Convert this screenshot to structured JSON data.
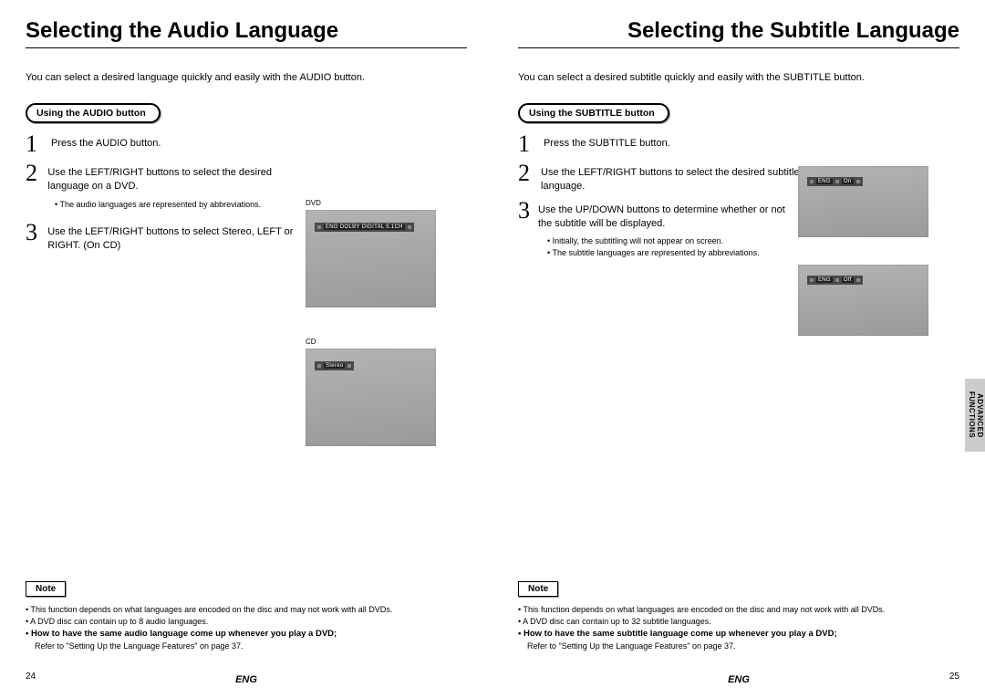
{
  "left": {
    "title": "Selecting the Audio Language",
    "intro": "You can select a desired language quickly and easily with the AUDIO button.",
    "pill": "Using the AUDIO button",
    "steps": [
      {
        "n": "1",
        "text": "Press the AUDIO button."
      },
      {
        "n": "2",
        "text": "Use the LEFT/RIGHT buttons to select the desired language on a DVD."
      },
      {
        "n": "3",
        "text": "Use the LEFT/RIGHT buttons to select Stereo, LEFT or RIGHT. (On CD)"
      }
    ],
    "sub_after_2": "The audio languages are represented by abbreviations.",
    "screens": {
      "dvd_label": "DVD",
      "dvd_bar": "ENG DOLBY DIGITAL 5.1CH",
      "cd_label": "CD",
      "cd_bar": "Stereo"
    },
    "note": {
      "label": "Note",
      "lines": [
        "This function depends on what languages are encoded on the disc and may not work with all DVDs.",
        "A DVD disc can contain up to 8 audio languages."
      ],
      "bold": "How to have the same audio language come up whenever you play a DVD;",
      "refer": "Refer to \"Setting Up the Language Features\" on page 37."
    },
    "pagenum": "24",
    "lang": "ENG"
  },
  "right": {
    "title": "Selecting the Subtitle Language",
    "intro": "You can select a desired subtitle quickly and easily with the SUBTITLE button.",
    "pill": "Using the SUBTITLE button",
    "steps": [
      {
        "n": "1",
        "text": "Press the SUBTITLE button."
      },
      {
        "n": "2",
        "text": "Use the LEFT/RIGHT buttons to select the desired subtitle language."
      },
      {
        "n": "3",
        "text": "Use the UP/DOWN buttons to determine whether or not the subtitle will be displayed."
      }
    ],
    "sub_after_3a": "Initially, the subtitling will not appear on screen.",
    "sub_after_3b": "The subtitle languages are represented by abbreviations.",
    "screens": {
      "on_bar_a": "ENG",
      "on_bar_b": "On",
      "off_bar_a": "ENG",
      "off_bar_b": "Off"
    },
    "note": {
      "label": "Note",
      "lines": [
        "This function depends on what languages are encoded on the disc and may not work with all DVDs.",
        "A DVD disc can contain up to 32 subtitle languages."
      ],
      "bold": "How to have the same subtitle language come up whenever you play a DVD;",
      "refer": "Refer to \"Setting Up the Language Features\" on page 37."
    },
    "pagenum": "25",
    "lang": "ENG",
    "tab": "ADVANCED\nFUNCTIONS"
  }
}
